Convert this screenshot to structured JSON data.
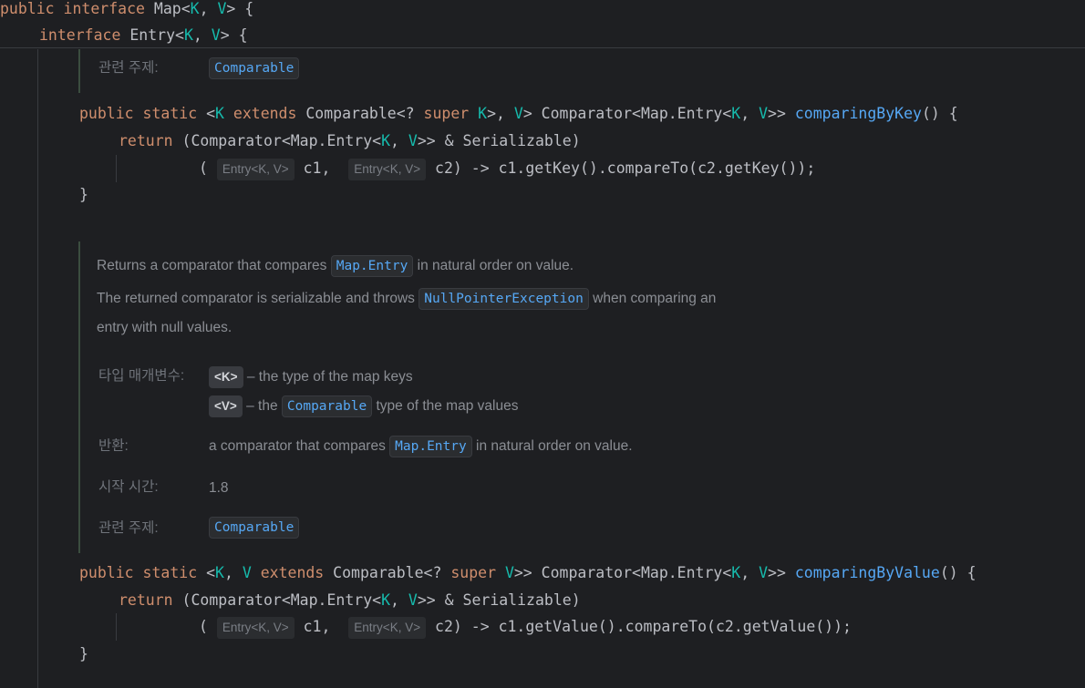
{
  "sticky": {
    "line1": {
      "kw": "public interface ",
      "name": "Map<",
      "k": "K",
      ",": ", ",
      "v": "V",
      "end": "> {"
    },
    "line2": {
      "kw": "interface ",
      "name": "Entry<",
      "k": "K",
      "sep": ", ",
      "v": "V",
      "end": "> {"
    }
  },
  "doc1": {
    "label": "관련 주제:",
    "chip": "Comparable"
  },
  "method1": {
    "l1": {
      "kw": "public static ",
      "p1": "<",
      "k": "K",
      "p2": " ",
      "ext": "extends",
      "p3": " Comparable<? ",
      "sup": "super",
      "p4": " ",
      "k2": "K",
      ">, ": ">, ",
      "v": "V",
      "p5": "> Comparator<Map.Entry<",
      "k3": "K",
      "p6": ", ",
      "v2": "V",
      "p7": ">> ",
      "fn": "comparingByKey",
      "p8": "() {"
    },
    "l2": {
      "kw": "return",
      "rest": " (Comparator<Map.Entry<",
      "k": "K",
      "sep": ", ",
      "v": "V",
      "rest2": ">> & Serializable)"
    },
    "l3": {
      "open": "(",
      "hint1": "Entry<K, V>",
      "c1": "c1, ",
      "hint2": "Entry<K, V>",
      "rest": "c2) -> c1.getKey().compareTo(c2.getKey());"
    },
    "close": "}"
  },
  "doc2": {
    "p1a": "Returns a comparator that compares ",
    "p1chip": "Map.Entry",
    "p1b": " in natural order on value.",
    "p2a": "The returned comparator is serializable and throws ",
    "p2chip": "NullPointerException",
    "p2b": " when comparing an",
    "p3": "entry with null values.",
    "params_label": "타입 매개변수:",
    "param1_chip": "<K>",
    "param1_text": " – the type of the map keys",
    "param2_chip": "<V>",
    "param2_text_a": " – the ",
    "param2_code": "Comparable",
    "param2_text_b": " type of the map values",
    "returns_label": "반환:",
    "returns_a": "a comparator that compares ",
    "returns_chip": "Map.Entry",
    "returns_b": " in natural order on value.",
    "since_label": "시작 시간:",
    "since_value": "1.8",
    "see_label": "관련 주제:",
    "see_chip": "Comparable"
  },
  "method2": {
    "l1": {
      "kw": "public static ",
      "p1": "<",
      "k": "K",
      "p2": ", ",
      "v": "V",
      "p3": " ",
      "ext": "extends",
      "p4": " Comparable<? ",
      "sup": "super",
      "p5": " ",
      "v2": "V",
      "p6": ">> Comparator<Map.Entry<",
      "k3": "K",
      "p7": ", ",
      "v3": "V",
      "p8": ">> ",
      "fn": "comparingByValue",
      "p9": "() {"
    },
    "l2": {
      "kw": "return",
      "rest": " (Comparator<Map.Entry<",
      "k": "K",
      "sep": ", ",
      "v": "V",
      "rest2": ">> & Serializable)"
    },
    "l3": {
      "open": "(",
      "hint1": "Entry<K, V>",
      "c1": "c1, ",
      "hint2": "Entry<K, V>",
      "rest": "c2) -> c1.getValue().compareTo(c2.getValue());"
    },
    "close": "}"
  },
  "colors": {
    "background": "#1e1f22",
    "keyword": "#cf8e6d",
    "type_param": "#16baac",
    "method": "#56a8f5",
    "text": "#bcbec4"
  }
}
